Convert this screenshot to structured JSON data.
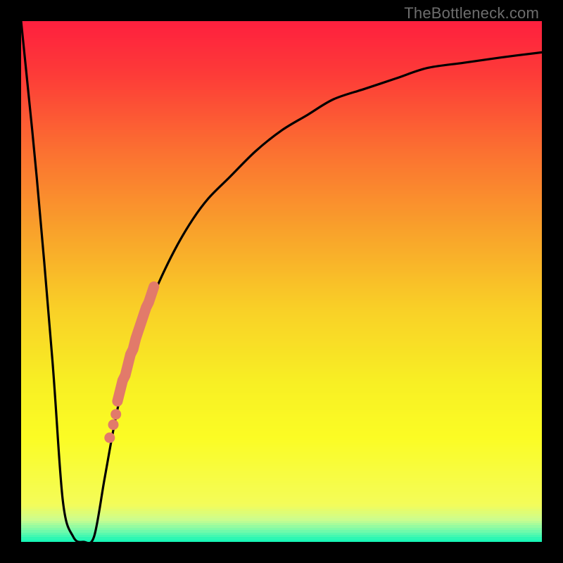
{
  "watermark": "TheBottleneck.com",
  "colors": {
    "frame": "#000000",
    "curve": "#000000",
    "marker": "#e27a6a",
    "gradient_stops": [
      {
        "pos": 0.0,
        "color": "#fe203e"
      },
      {
        "pos": 0.1,
        "color": "#fd3b38"
      },
      {
        "pos": 0.25,
        "color": "#fb7131"
      },
      {
        "pos": 0.4,
        "color": "#f9a12b"
      },
      {
        "pos": 0.55,
        "color": "#f9cf27"
      },
      {
        "pos": 0.7,
        "color": "#f8f024"
      },
      {
        "pos": 0.8,
        "color": "#fbfc24"
      },
      {
        "pos": 0.93,
        "color": "#f4fc59"
      },
      {
        "pos": 0.96,
        "color": "#cbfd8f"
      },
      {
        "pos": 0.98,
        "color": "#77faaa"
      },
      {
        "pos": 1.0,
        "color": "#19f6b6"
      }
    ]
  },
  "chart_data": {
    "type": "line",
    "title": "",
    "xlabel": "",
    "ylabel": "",
    "xlim": [
      0,
      100
    ],
    "ylim": [
      0,
      100
    ],
    "series": [
      {
        "name": "bottleneck-curve",
        "x": [
          0,
          3,
          6,
          8,
          10,
          12,
          14,
          16,
          18,
          20,
          22,
          24,
          27,
          30,
          33,
          36,
          40,
          45,
          50,
          55,
          60,
          66,
          72,
          78,
          85,
          92,
          100
        ],
        "y": [
          100,
          70,
          35,
          8,
          1,
          0,
          1,
          12,
          23,
          32,
          38,
          44,
          51,
          57,
          62,
          66,
          70,
          75,
          79,
          82,
          85,
          87,
          89,
          91,
          92,
          93,
          94
        ]
      }
    ],
    "marker_band": {
      "name": "highlighted-range",
      "x": [
        18.5,
        19.0,
        19.5,
        20.0,
        20.5,
        21.0,
        21.5,
        22.0,
        22.5,
        23.0,
        23.5,
        24.0,
        24.5,
        25.0,
        25.5
      ],
      "y": [
        27,
        29,
        31,
        32,
        34,
        36,
        37,
        39,
        40.5,
        42,
        43.5,
        45,
        46,
        47.5,
        49
      ]
    },
    "marker_dots": {
      "name": "highlighted-points",
      "x": [
        17.0,
        17.7,
        18.2
      ],
      "y": [
        20.0,
        22.5,
        24.5
      ]
    }
  }
}
